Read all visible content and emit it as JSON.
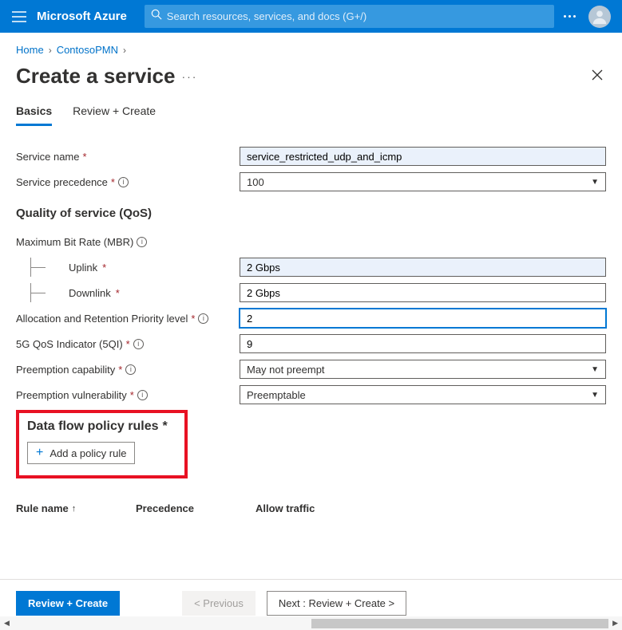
{
  "header": {
    "brand": "Microsoft Azure",
    "search_placeholder": "Search resources, services, and docs (G+/)"
  },
  "breadcrumb": {
    "home": "Home",
    "item1": "ContosoPMN"
  },
  "page": {
    "title": "Create a service"
  },
  "tabs": {
    "basics": "Basics",
    "review": "Review + Create"
  },
  "form": {
    "service_name_label": "Service name",
    "service_name_value": "service_restricted_udp_and_icmp",
    "service_precedence_label": "Service precedence",
    "service_precedence_value": "100",
    "qos_heading": "Quality of service (QoS)",
    "mbr_label": "Maximum Bit Rate (MBR)",
    "uplink_label": "Uplink",
    "uplink_value": "2 Gbps",
    "downlink_label": "Downlink",
    "downlink_value": "2 Gbps",
    "arp_label": "Allocation and Retention Priority level",
    "arp_value": "2",
    "qos5g_label": "5G QoS Indicator (5QI)",
    "qos5g_value": "9",
    "preempt_cap_label": "Preemption capability",
    "preempt_cap_value": "May not preempt",
    "preempt_vuln_label": "Preemption vulnerability",
    "preempt_vuln_value": "Preemptable"
  },
  "policy": {
    "heading": "Data flow policy rules",
    "add_button": "Add a policy rule",
    "col_rule_name": "Rule name",
    "col_precedence": "Precedence",
    "col_allow": "Allow traffic"
  },
  "footer": {
    "review": "Review + Create",
    "previous": "< Previous",
    "next": "Next : Review + Create >"
  }
}
